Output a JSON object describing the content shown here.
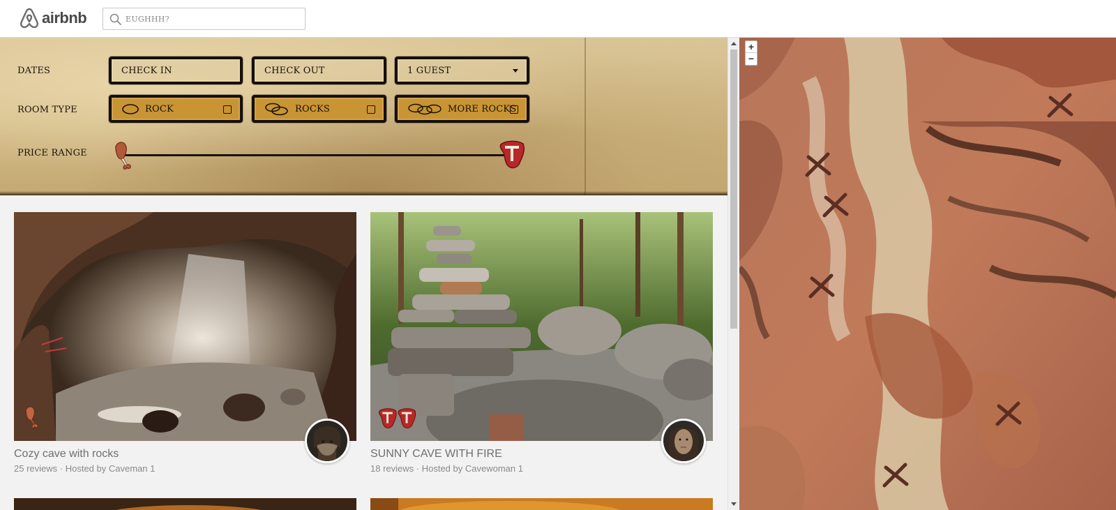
{
  "header": {
    "logo_text": "airbnb",
    "search_placeholder": "EUGHHH?"
  },
  "filters": {
    "dates_label": "DATES",
    "check_in": "CHECK IN",
    "check_out": "CHECK OUT",
    "guests": "1 GUEST",
    "room_type_label": "ROOM TYPE",
    "room_types": [
      {
        "label": "ROCK",
        "icon": "single-rock-icon",
        "checked": false
      },
      {
        "label": "ROCKS",
        "icon": "two-rocks-icon",
        "checked": false
      },
      {
        "label": "MORE ROCKS",
        "icon": "rock-pile-icon",
        "checked": false
      }
    ],
    "price_range_label": "PRICE RANGE",
    "price_min_icon": "drumstick-icon",
    "price_max_icon": "steak-icon",
    "price_range": [
      0,
      1
    ]
  },
  "listings": [
    {
      "title": "Cozy cave with rocks",
      "reviews": "25 reviews",
      "host": "Hosted by Caveman 1",
      "price_icon": "drumstick-icon"
    },
    {
      "title": "SUNNY CAVE WITH FIRE",
      "reviews": "18 reviews",
      "host": "Hosted by Cavewoman 1",
      "price_icon": "double-steak-icon"
    }
  ],
  "map": {
    "zoom_in": "+",
    "zoom_out": "−",
    "marker_icon": "x-mark-icon"
  },
  "colors": {
    "stone_gold": "#c99433",
    "parchment": "#d2bb88",
    "map_marker": "#5a2e22"
  }
}
